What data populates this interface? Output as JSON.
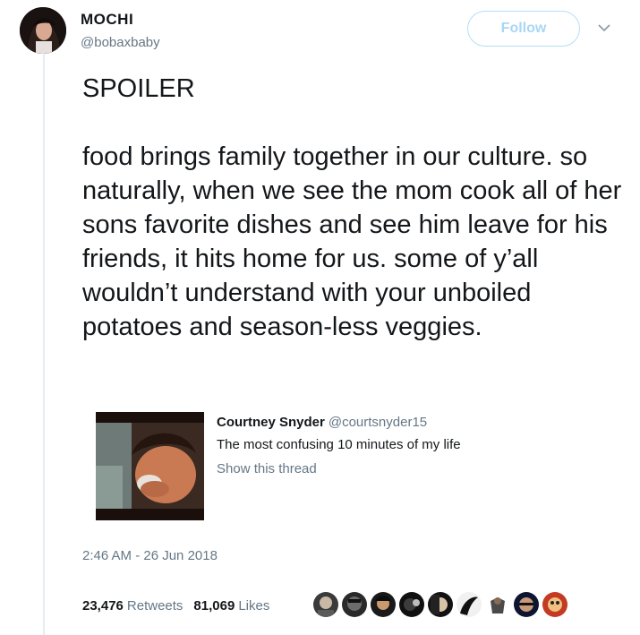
{
  "author": {
    "name": "MOCHI",
    "handle": "@bobaxbaby"
  },
  "header": {
    "follow_label": "Follow"
  },
  "tweet": {
    "paragraphs": [
      "SPOILER",
      "food brings family together in our culture. so naturally, when we see the mom cook all of her sons favorite dishes and see him leave for his friends, it hits home for us. some of y’all wouldn’t understand with your unboiled potatoes and season-less veggies."
    ],
    "timestamp": "2:46 AM - 26 Jun 2018"
  },
  "quote": {
    "name": "Courtney Snyder",
    "handle": "@courtsnyder15",
    "text": "The most confusing 10 minutes of my life",
    "link": "Show this thread"
  },
  "stats": {
    "retweets_count": "23,476",
    "retweets_label": "Retweets",
    "likes_count": "81,069",
    "likes_label": "Likes"
  },
  "colors": {
    "accent": "#1da1f2",
    "follow_border": "#b3dffa",
    "muted": "#657786",
    "thread_line": "#e6ecf0"
  },
  "icons": {
    "more": "chevron-down-icon"
  }
}
